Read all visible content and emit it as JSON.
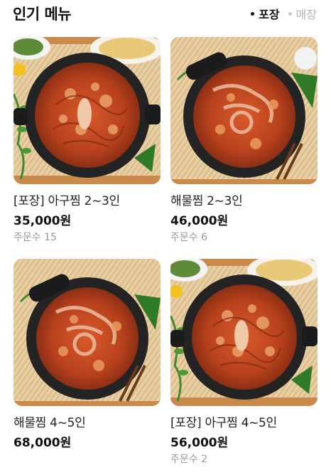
{
  "header": {
    "title": "인기 메뉴",
    "tabs": [
      {
        "label": "포장",
        "active": true
      },
      {
        "label": "매장",
        "active": false
      }
    ]
  },
  "colors": {
    "table_wood": "#c98a4b",
    "placemat": "#ead2a8",
    "pan": "#262626",
    "sauce": "#c84a24",
    "leaf": "#3f8a2e"
  },
  "menu": [
    {
      "name": "[포장] 아구찜 2~3인",
      "price": "35,000원",
      "orders": "주문수 15",
      "image": "braised-monkfish-dish-photo"
    },
    {
      "name": "해물찜 2~3인",
      "price": "46,000원",
      "orders": "주문수 6",
      "image": "braised-seafood-dish-photo"
    },
    {
      "name": "해물찜 4~5인",
      "price": "68,000원",
      "image": "braised-seafood-dish-photo"
    },
    {
      "name": "[포장] 아구찜 4~5인",
      "price": "56,000원",
      "orders": "주문수 2",
      "image": "braised-monkfish-dish-photo"
    }
  ]
}
